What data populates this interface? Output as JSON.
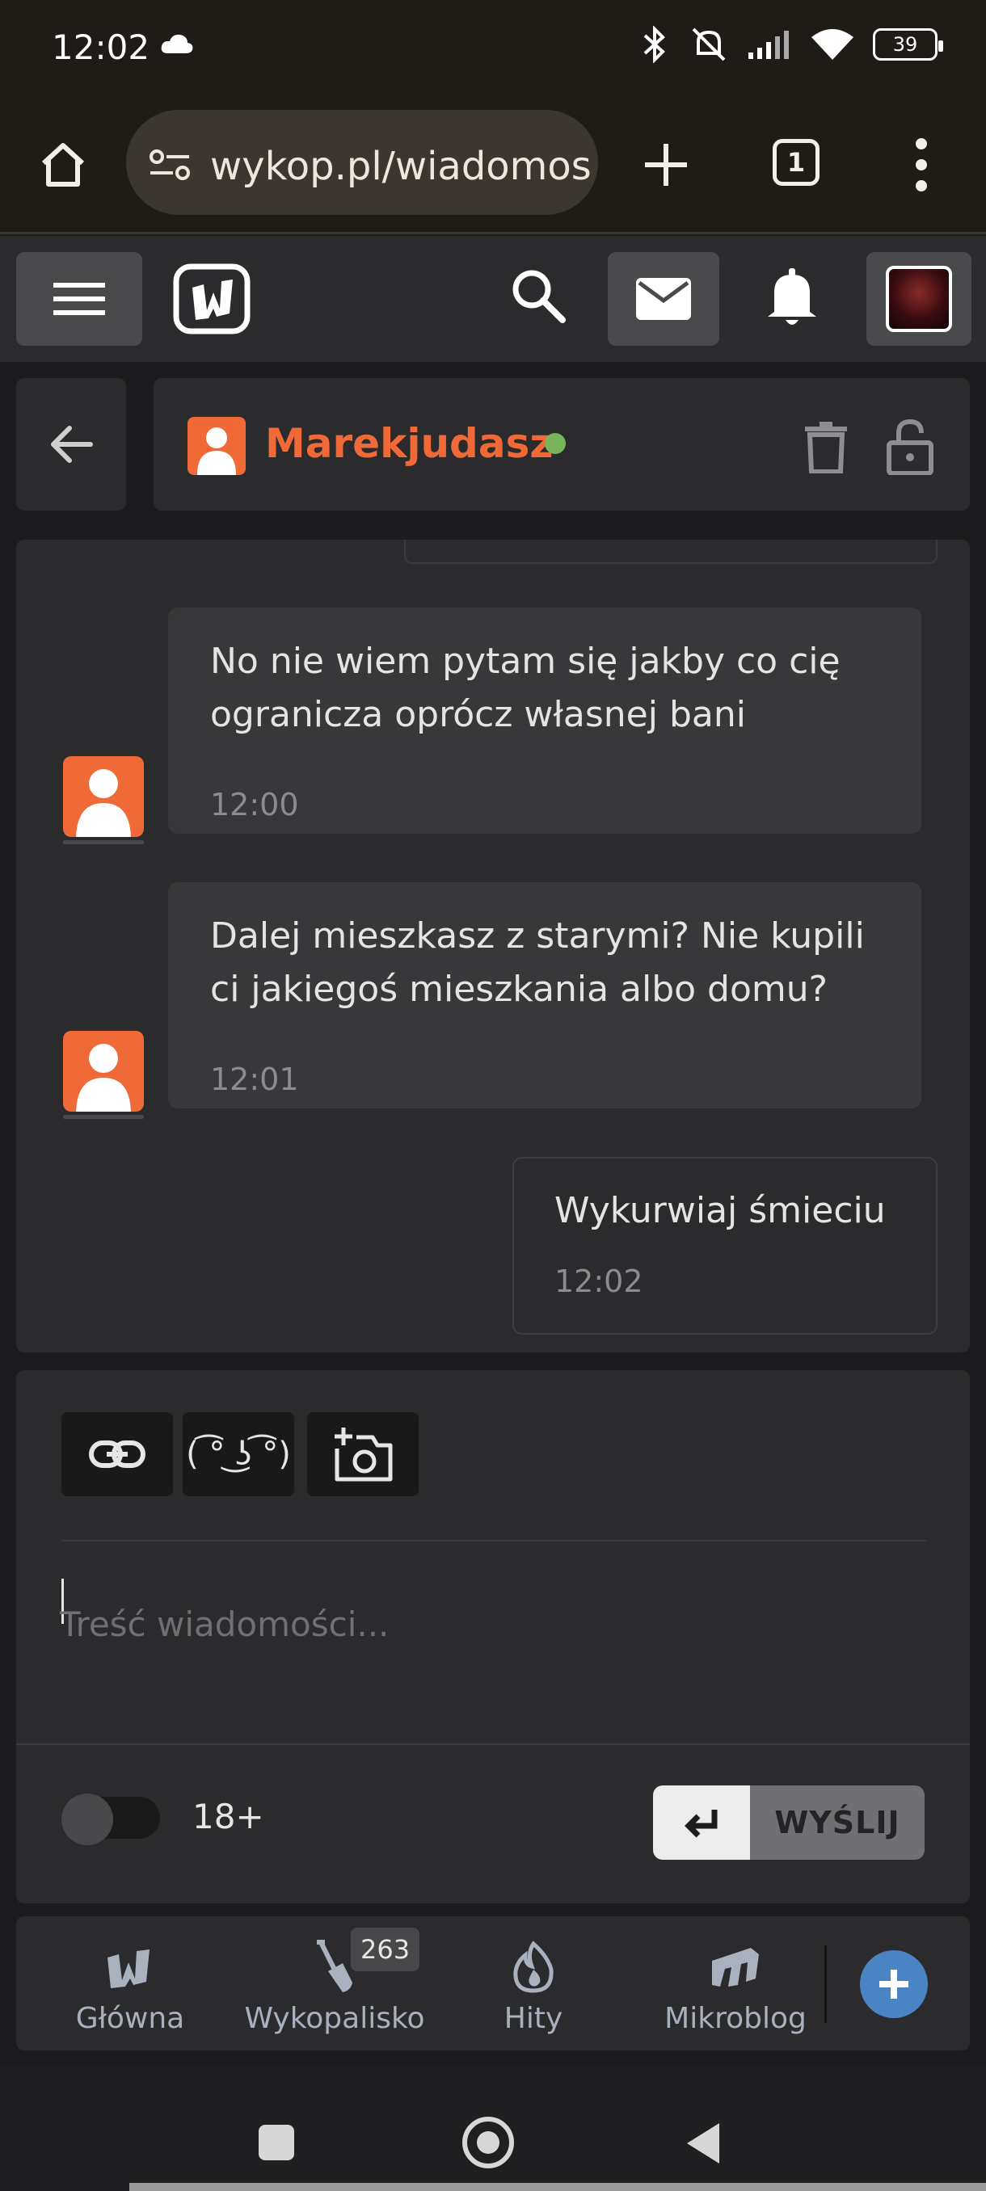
{
  "status_bar": {
    "time": "12:02",
    "battery": "39"
  },
  "browser": {
    "url": "wykop.pl/wiadomos",
    "tab_count": "1"
  },
  "conversation": {
    "username": "Marekjudasz",
    "online": true
  },
  "messages": [
    {
      "from": "other",
      "text": "No nie wiem pytam się jakby co cię ogranicza oprócz własnej bani",
      "time": "12:00"
    },
    {
      "from": "other",
      "text": "Dalej mieszkasz z starymi? Nie kupili ci jakiegoś mieszkania albo domu?",
      "time": "12:01"
    },
    {
      "from": "me",
      "text": "Wykurwiaj śmieciu",
      "time": "12:02"
    }
  ],
  "compose": {
    "lenny_label": "( ͡° ͜ʖ ͡°)",
    "placeholder": "Treść wiadomości...",
    "toggle_label": "18+",
    "send_label": "WYŚLIJ"
  },
  "bottom_nav": {
    "items": [
      {
        "label": "Główna",
        "icon": "wykop-logo-icon"
      },
      {
        "label": "Wykopalisko",
        "icon": "shovel-icon",
        "badge": "263"
      },
      {
        "label": "Hity",
        "icon": "flame-icon"
      },
      {
        "label": "Mikroblog",
        "icon": "mikroblog-icon"
      }
    ]
  },
  "colors": {
    "accent": "#ef6a37",
    "online": "#79b45b",
    "panel": "#2b2b2d",
    "background": "#1c1c1e",
    "fab": "#4a84c4"
  }
}
